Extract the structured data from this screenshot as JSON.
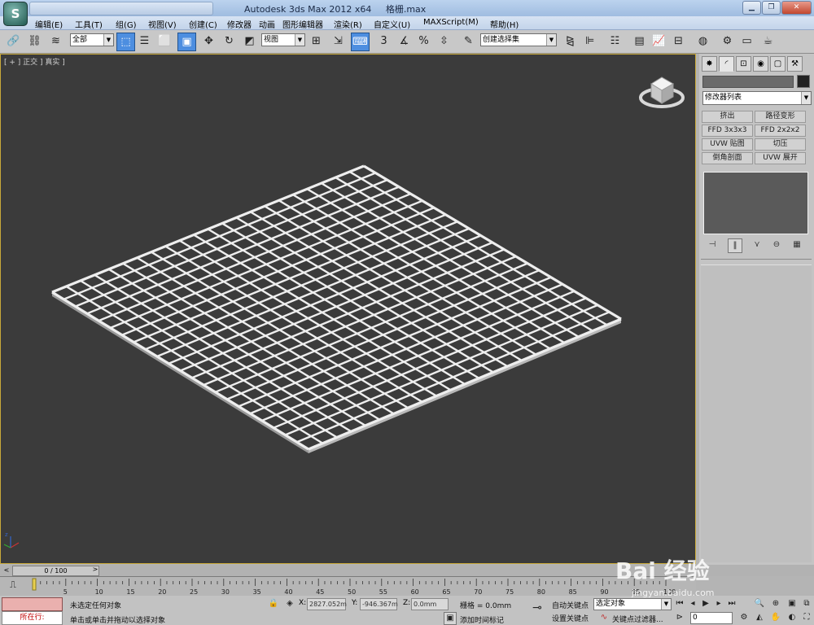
{
  "window": {
    "title": "Autodesk 3ds Max  2012 x64",
    "file": "格栅.max",
    "logo_letter": "S",
    "controls": [
      "minimize-icon",
      "restore-icon",
      "close-icon"
    ]
  },
  "menu": [
    "编辑(E)",
    "工具(T)",
    "组(G)",
    "视图(V)",
    "创建(C)",
    "修改器",
    "动画",
    "图形编辑器",
    "渲染(R)",
    "自定义(U)",
    "MAXScript(M)",
    "帮助(H)"
  ],
  "toolbar": {
    "selection_filter": "全部",
    "ref_coord": "视图",
    "named_selection": "创建选择集"
  },
  "viewport": {
    "label": "[ + ] 正交 ] 真实 ]",
    "background": "#3b3b3b",
    "grid": {
      "rows": 22,
      "cols": 22,
      "color": "#eeeeee"
    }
  },
  "command_panel": {
    "modifier_list": "修改器列表",
    "modifier_buttons": [
      "挤出",
      "路径变形",
      "FFD 3x3x3",
      "FFD 2x2x2",
      "UVW 贴图",
      "切压",
      "倒角剖面",
      "UVW 展开"
    ],
    "tabs": [
      "create-tab",
      "modify-tab",
      "hierarchy-tab",
      "motion-tab",
      "display-tab",
      "utilities-tab"
    ]
  },
  "timeline": {
    "frame_display": "0 / 100",
    "ticks": [
      0,
      5,
      10,
      15,
      20,
      25,
      30,
      35,
      40,
      45,
      50,
      55,
      60,
      65,
      70,
      75,
      80,
      85,
      90,
      95,
      100
    ]
  },
  "status": {
    "maxscript_label": "所在行:",
    "selection_status": "未选定任何对象",
    "prompt": "单击或单击并拖动以选择对象",
    "x_label": "X:",
    "x_value": "2827.052m",
    "y_label": "Y:",
    "y_value": "-946.367m",
    "z_label": "Z:",
    "z_value": "0.0mm",
    "grid_label": "栅格 = 0.0mm",
    "add_time_tag": "添加时间标记",
    "auto_key": "自动关键点",
    "set_key": "设置关键点",
    "selected_object": "选定对象",
    "key_filter": "关键点过滤器...",
    "frame_value": "0"
  },
  "watermark": {
    "logo": "Bai 经验",
    "url": "jingyan.baidu.com"
  }
}
